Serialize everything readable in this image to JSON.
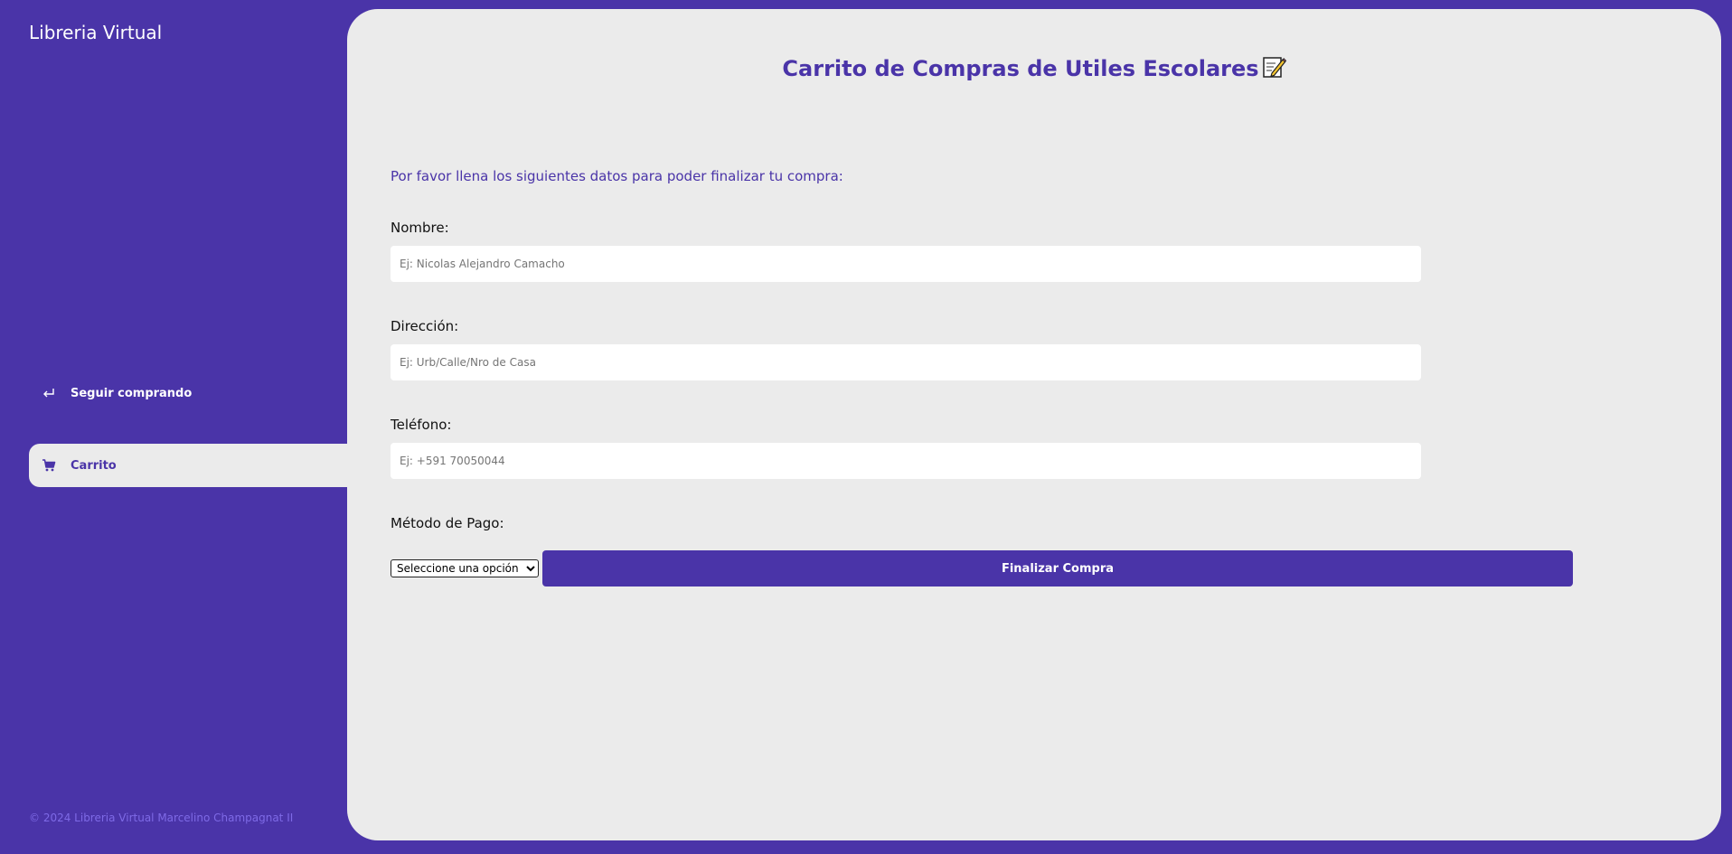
{
  "sidebar": {
    "brand": "Libreria Virtual",
    "items": [
      {
        "label": "Seguir comprando",
        "icon": "return-arrow-icon",
        "active": false
      },
      {
        "label": "Carrito",
        "icon": "cart-icon",
        "active": true
      }
    ],
    "footer": "© 2024 Libreria Virtual Marcelino Champagnat II"
  },
  "main": {
    "title": "Carrito de Compras de Utiles Escolares",
    "title_icon": "memo-icon",
    "intro": "Por favor llena los siguientes datos para poder finalizar tu compra:",
    "form": {
      "name_label": "Nombre:",
      "name_placeholder": "Ej: Nicolas Alejandro Camacho",
      "address_label": "Dirección:",
      "address_placeholder": "Ej: Urb/Calle/Nro de Casa",
      "phone_label": "Teléfono:",
      "phone_placeholder": "Ej: +591 70050044",
      "payment_label": "Método de Pago:",
      "payment_selected": "Seleccione una opción",
      "submit_label": "Finalizar Compra"
    }
  },
  "colors": {
    "primary": "#4a34a8",
    "content_bg": "#ebebeb",
    "footer_text": "#7e6ae6"
  }
}
